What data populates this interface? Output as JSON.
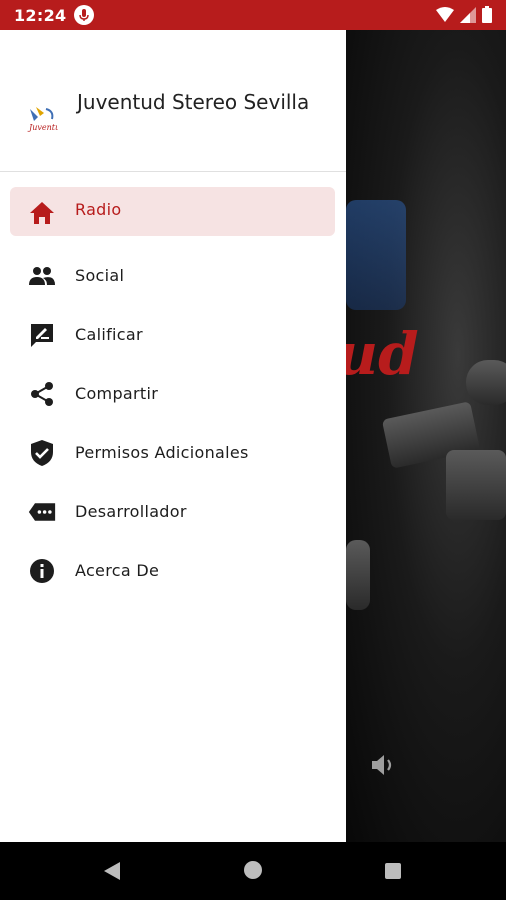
{
  "status_bar": {
    "time": "12:24",
    "icons": [
      "mic-icon",
      "wifi-icon",
      "signal-icon",
      "battery-icon"
    ],
    "bg_color": "#b71c1c"
  },
  "drawer": {
    "app_title": "Juventud Stereo Sevilla",
    "logo_icon": "app-logo-icon",
    "menu": [
      {
        "label": "Radio",
        "icon": "home-icon",
        "active": true
      },
      {
        "label": "Social",
        "icon": "people-icon",
        "active": false
      },
      {
        "label": "Calificar",
        "icon": "rate-review-icon",
        "active": false
      },
      {
        "label": "Compartir",
        "icon": "share-icon",
        "active": false
      },
      {
        "label": "Permisos Adicionales",
        "icon": "shield-check-icon",
        "active": false
      },
      {
        "label": "Desarrollador",
        "icon": "developer-tag-icon",
        "active": false
      },
      {
        "label": "Acerca De",
        "icon": "info-icon",
        "active": false
      }
    ]
  },
  "colors": {
    "accent": "#b71c1c",
    "active_bg": "#f6e3e3"
  },
  "nav_bar": {
    "icons": [
      "back-icon",
      "home-circle-icon",
      "recents-icon"
    ]
  }
}
